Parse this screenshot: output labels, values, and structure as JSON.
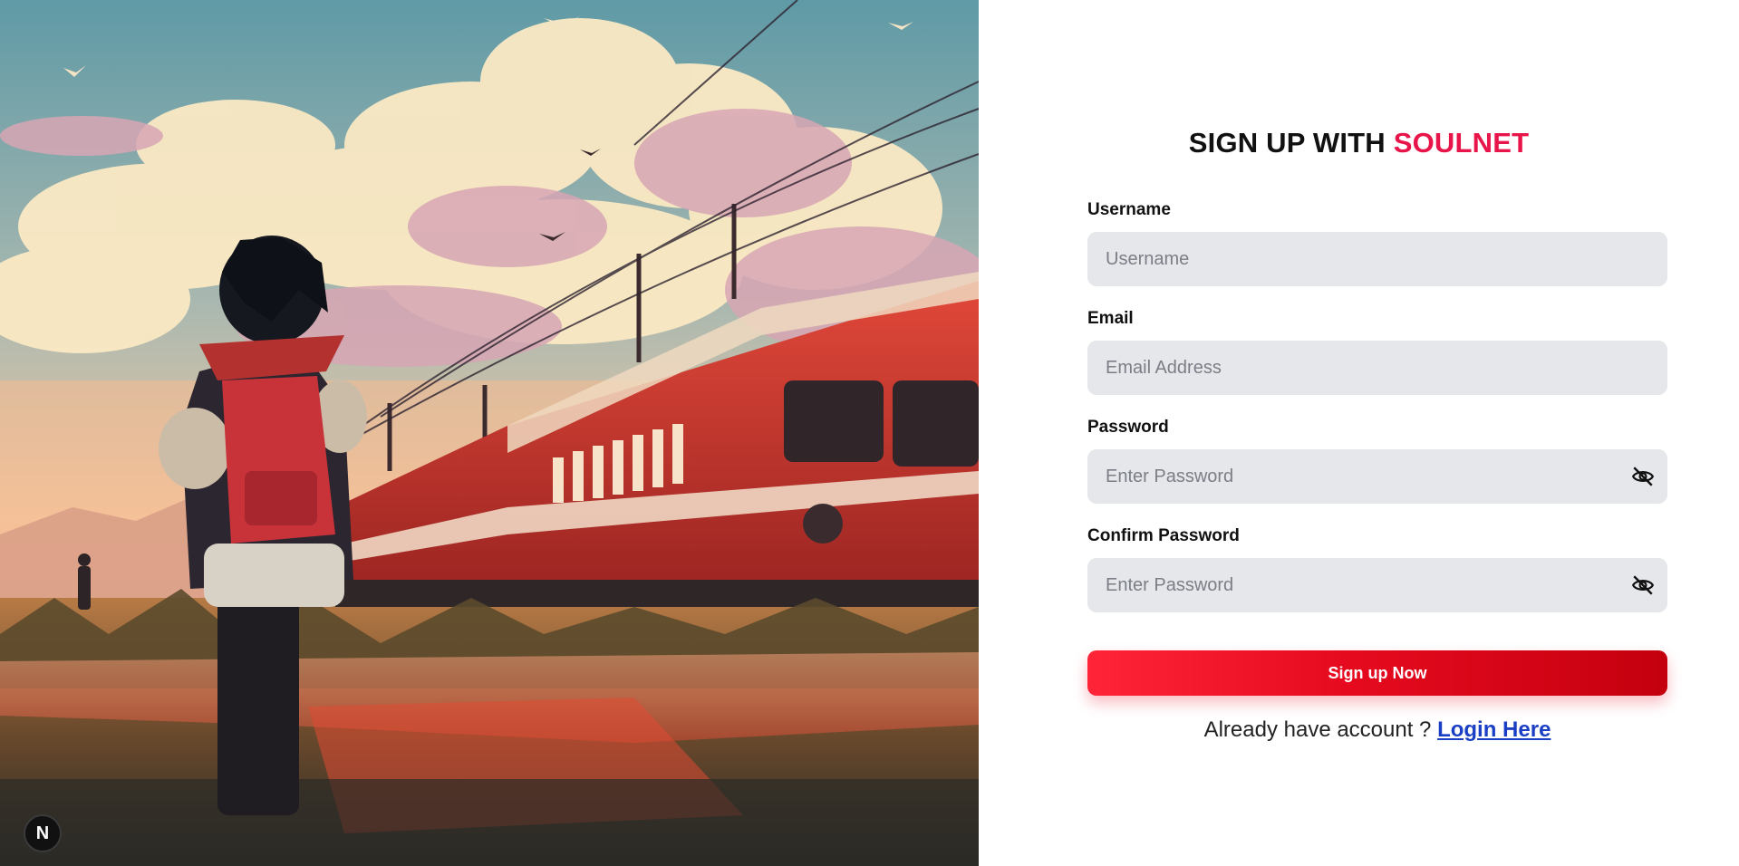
{
  "hero": {
    "image_description": "anime illustration of a girl with a red backpack watching a red train at sunset",
    "badge_letter": "N"
  },
  "form": {
    "title_prefix": "SIGN UP WITH",
    "title_brand": "SOULNET",
    "brand_color": "#e8154a",
    "fields": [
      {
        "label": "Username",
        "placeholder": "Username",
        "value": ""
      },
      {
        "label": "Email",
        "placeholder": "Email Address",
        "value": ""
      },
      {
        "label": "Password",
        "placeholder": "Enter Password",
        "value": "",
        "icon": "eye-off-icon"
      },
      {
        "label": "Confirm Password",
        "placeholder": "Enter Password",
        "value": "",
        "icon": "eye-off-icon"
      }
    ],
    "submit_label": "Sign up Now",
    "submit_colors": [
      "#ff2438",
      "#c4000e"
    ],
    "login_prompt": "Already have account ?",
    "login_link": "Login Here",
    "link_color": "#1b3fc4"
  }
}
